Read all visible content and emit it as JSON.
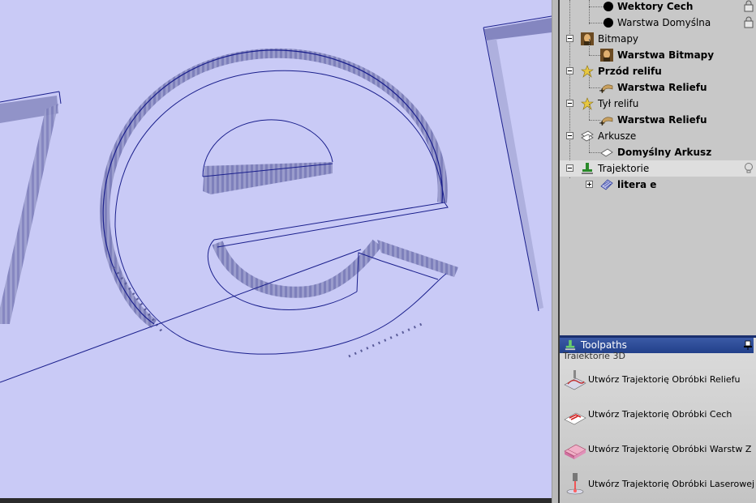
{
  "project_tree": {
    "items": [
      {
        "label": "Wektory Cech",
        "bold": true
      },
      {
        "label": "Warstwa Domyślna",
        "bold": false
      },
      {
        "label": "Bitmapy",
        "bold": false
      },
      {
        "label": "Warstwa Bitmapy",
        "bold": true
      },
      {
        "label": "Przód relifu",
        "bold": true
      },
      {
        "label": "Warstwa Reliefu",
        "bold": true
      },
      {
        "label": "Tył relifu",
        "bold": false
      },
      {
        "label": "Warstwa Reliefu",
        "bold": true
      },
      {
        "label": "Arkusze",
        "bold": false
      },
      {
        "label": "Domyślny Arkusz",
        "bold": true
      },
      {
        "label": "Trajektorie",
        "bold": false
      },
      {
        "label": "litera e",
        "bold": true
      }
    ]
  },
  "toolpaths_panel": {
    "title": "Toolpaths",
    "subtitle": "Trajektorie 3D",
    "actions": [
      {
        "label": "Utwórz Trajektorię Obróbki Reliefu"
      },
      {
        "label": "Utwórz Trajektorię Obróbki Cech"
      },
      {
        "label": "Utwórz Trajektorię Obróbki Warstw Z"
      },
      {
        "label": "Utwórz Trajektorię Obróbki Laserowej"
      }
    ]
  },
  "colors": {
    "viewport_bg": "#c9caf6",
    "toolpath_line": "#1a1f8c",
    "panel_header": "#22408a"
  }
}
